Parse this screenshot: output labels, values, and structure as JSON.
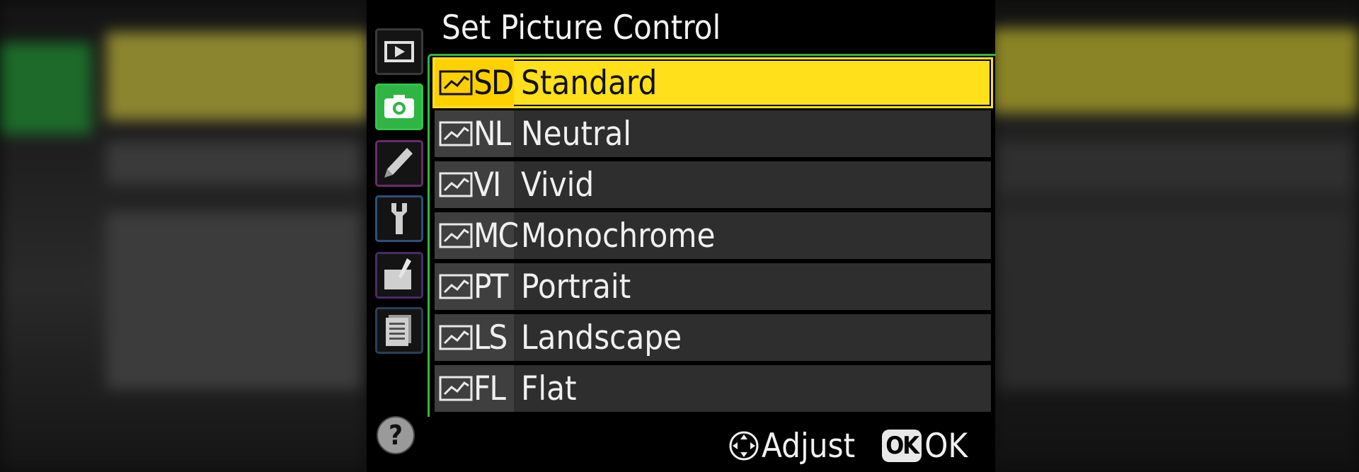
{
  "screen": {
    "title": "Set Picture Control",
    "colors": {
      "selected": "#ffe01a",
      "active_tab": "#2fb544",
      "item_bg": "#2e2e2e",
      "text": "#f0f0f0"
    }
  },
  "sidebar": {
    "tabs": [
      {
        "icon": "playback-icon",
        "active": false
      },
      {
        "icon": "camera-icon",
        "active": true
      },
      {
        "icon": "pencil-icon",
        "active": false
      },
      {
        "icon": "wrench-icon",
        "active": false
      },
      {
        "icon": "retouch-icon",
        "active": false
      },
      {
        "icon": "my-menu-icon",
        "active": false
      }
    ],
    "help": "?"
  },
  "menu": {
    "items": [
      {
        "code": "SD",
        "label": "Standard",
        "selected": true
      },
      {
        "code": "NL",
        "label": "Neutral",
        "selected": false
      },
      {
        "code": "VI",
        "label": "Vivid",
        "selected": false
      },
      {
        "code": "MC",
        "label": "Monochrome",
        "selected": false
      },
      {
        "code": "PT",
        "label": "Portrait",
        "selected": false
      },
      {
        "code": "LS",
        "label": "Landscape",
        "selected": false
      },
      {
        "code": "FL",
        "label": "Flat",
        "selected": false
      }
    ]
  },
  "footer": {
    "adjust_label": "Adjust",
    "ok_badge": "OK",
    "ok_label": "OK"
  }
}
